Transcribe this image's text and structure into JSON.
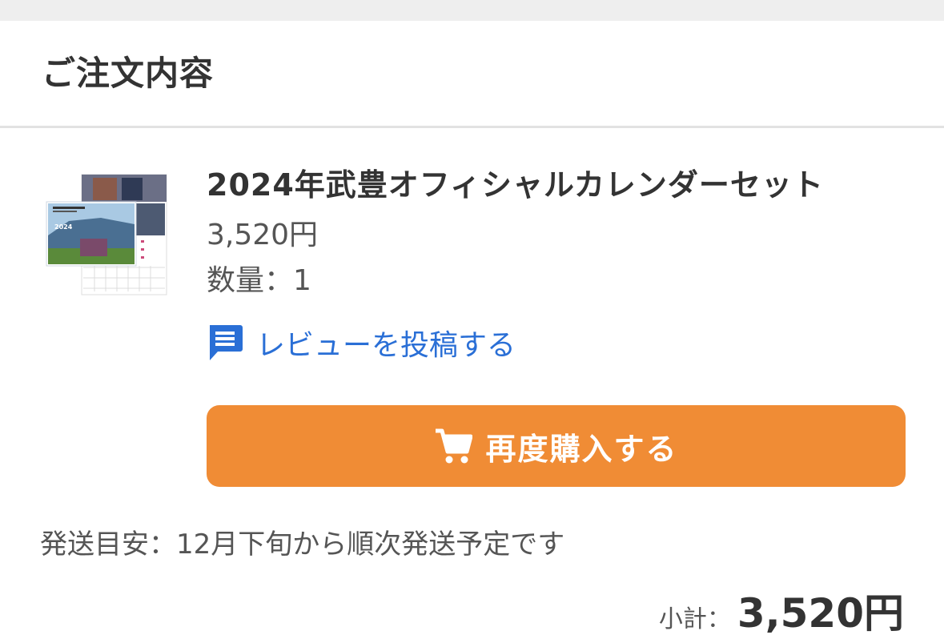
{
  "order": {
    "section_title": "ご注文内容"
  },
  "item": {
    "name": "2024年武豊オフィシャルカレンダーセット",
    "price": "3,520円",
    "quantity": "数量：1",
    "thumbnail_caption": "2024",
    "thumbnail_icon": "calendar-product-image"
  },
  "actions": {
    "review_label": "レビューを投稿する",
    "review_icon": "comment-icon",
    "rebuy_label": "再度購入する",
    "rebuy_icon": "cart-icon"
  },
  "shipping": {
    "text": "発送目安：12月下旬から順次発送予定です"
  },
  "summary": {
    "subtotal_label": "小計：",
    "subtotal_value": "3,520円"
  },
  "colors": {
    "accent": "#f08c35",
    "link": "#2a6fd6",
    "text": "#333333",
    "divider": "#e2e2e2",
    "top_band": "#eeeeee"
  }
}
